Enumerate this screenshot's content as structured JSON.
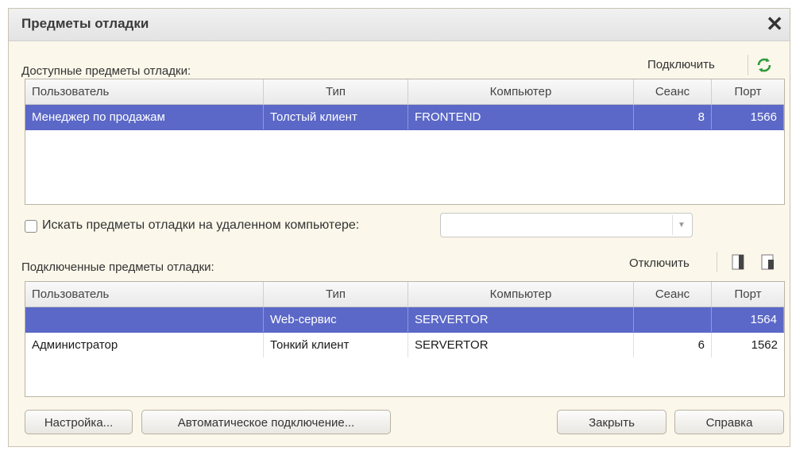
{
  "window": {
    "title": "Предметы отладки"
  },
  "available": {
    "label": "Доступные предметы отладки:",
    "connect_label": "Подключить",
    "columns": [
      "Пользователь",
      "Тип",
      "Компьютер",
      "Сеанс",
      "Порт"
    ],
    "rows": [
      {
        "user": "Менеджер по продажам",
        "type": "Толстый клиент",
        "computer": "FRONTEND",
        "session": "8",
        "port": "1566"
      }
    ]
  },
  "remote": {
    "checkbox_label": "Искать предметы отладки на удаленном компьютере:",
    "value": ""
  },
  "connected": {
    "label": "Подключенные предметы отладки:",
    "disconnect_label": "Отключить",
    "columns": [
      "Пользователь",
      "Тип",
      "Компьютер",
      "Сеанс",
      "Порт"
    ],
    "rows": [
      {
        "user": "",
        "type": "Web-сервис",
        "computer": "SERVERTOR",
        "session": "",
        "port": "1564"
      },
      {
        "user": "Администратор",
        "type": "Тонкий клиент",
        "computer": "SERVERTOR",
        "session": "6",
        "port": "1562"
      }
    ]
  },
  "buttons": {
    "settings": "Настройка...",
    "auto_connect": "Автоматическое подключение...",
    "close": "Закрыть",
    "help": "Справка"
  },
  "colors": {
    "selection": "#5b68c7",
    "refresh_icon": "#2f9a3a"
  }
}
